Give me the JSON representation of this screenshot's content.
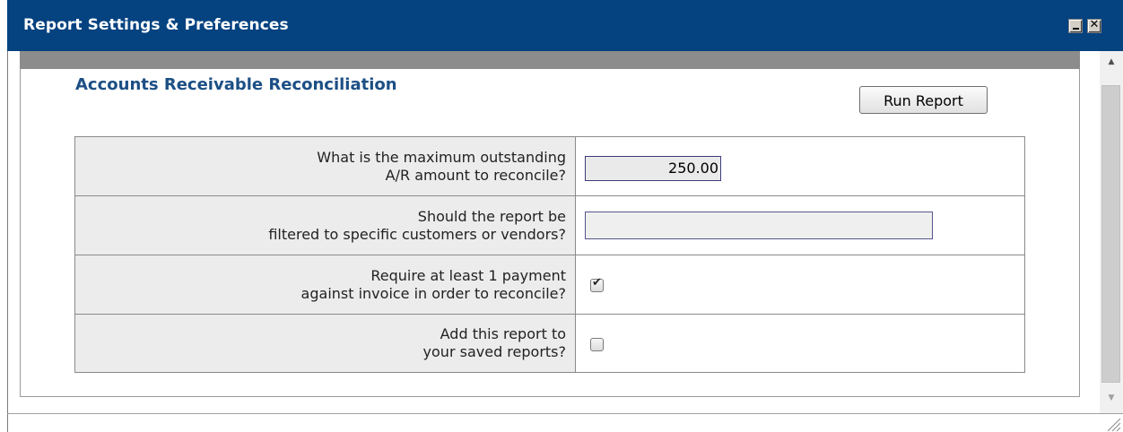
{
  "window": {
    "title": "Report Settings & Preferences"
  },
  "report": {
    "title": "Accounts Receivable Reconciliation",
    "run_label": "Run Report"
  },
  "questions": [
    {
      "line1": "What is the maximum outstanding",
      "line2": "A/R amount to reconcile?",
      "value": "250.00"
    },
    {
      "line1": "Should the report be",
      "line2": "filtered to specific customers or vendors?",
      "value": ""
    },
    {
      "line1": "Require at least 1 payment",
      "line2": "against invoice in order to reconcile?",
      "checked": true
    },
    {
      "line1": "Add this report to",
      "line2": "your saved reports?",
      "checked": false
    }
  ],
  "icons": {
    "minimize": "minimize-icon",
    "close": "close-icon",
    "scroll_up": "arrow-up-icon",
    "scroll_down": "arrow-down-icon",
    "resize": "resize-grip-icon"
  },
  "colors": {
    "titlebar": "#044280",
    "heading": "#1c4f85",
    "label_bg": "#ececec"
  }
}
